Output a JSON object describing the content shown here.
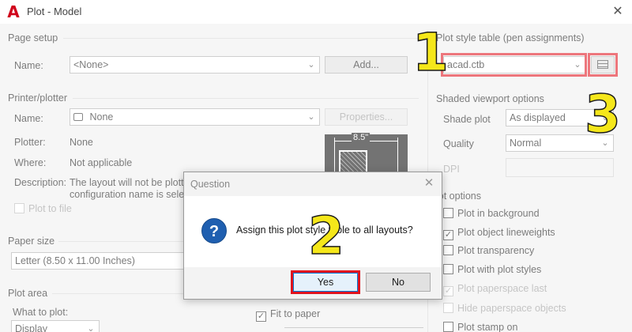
{
  "window": {
    "title": "Plot - Model",
    "close_glyph": "✕",
    "app_icon_glyph": "A"
  },
  "page_setup": {
    "group_label": "Page setup",
    "name_label": "Name:",
    "name_value": "<None>",
    "add_button": "Add..."
  },
  "printer": {
    "group_label": "Printer/plotter",
    "name_label": "Name:",
    "name_value": "None",
    "properties_button": "Properties...",
    "plotter_label": "Plotter:",
    "plotter_value": "None",
    "where_label": "Where:",
    "where_value": "Not applicable",
    "description_label": "Description:",
    "description_line1": "The layout will not be plotte",
    "description_line2": "configuration name is select",
    "plot_to_file": "Plot to file",
    "preview_width": "8.5\""
  },
  "paper_size": {
    "group_label": "Paper size",
    "value": "Letter (8.50 x 11.00 Inches)"
  },
  "plot_area": {
    "group_label": "Plot area",
    "what_label": "What to plot:",
    "what_value": "Display"
  },
  "fit_to_paper": "Fit to paper",
  "plot_style_table": {
    "group_label": "Plot style table (pen assignments)",
    "value": "acad.ctb",
    "edit_icon": "edit-table-icon"
  },
  "shaded_viewport": {
    "group_label": "Shaded viewport options",
    "shade_label": "Shade plot",
    "shade_value": "As displayed",
    "quality_label": "Quality",
    "quality_value": "Normal",
    "dpi_label": "DPI"
  },
  "plot_options": {
    "group_label": "lot options",
    "items": [
      {
        "label": "Plot in background",
        "checked": false,
        "disabled": false
      },
      {
        "label": "Plot object lineweights",
        "checked": true,
        "disabled": false
      },
      {
        "label": "Plot transparency",
        "checked": false,
        "disabled": false
      },
      {
        "label": "Plot with plot styles",
        "checked": false,
        "disabled": false
      },
      {
        "label": "Plot paperspace last",
        "checked": true,
        "disabled": true
      },
      {
        "label": "Hide paperspace objects",
        "checked": false,
        "disabled": true
      },
      {
        "label": "Plot stamp on",
        "checked": false,
        "disabled": false
      }
    ]
  },
  "question_dialog": {
    "title": "Question",
    "message": "Assign this plot style table to all layouts?",
    "yes_button": "Yes",
    "no_button": "No",
    "icon_glyph": "?"
  },
  "annotations": {
    "step1": "1",
    "step2": "2",
    "step3": "3",
    "highlight_color": "#e0141e",
    "number_color": "#f5e71a"
  }
}
